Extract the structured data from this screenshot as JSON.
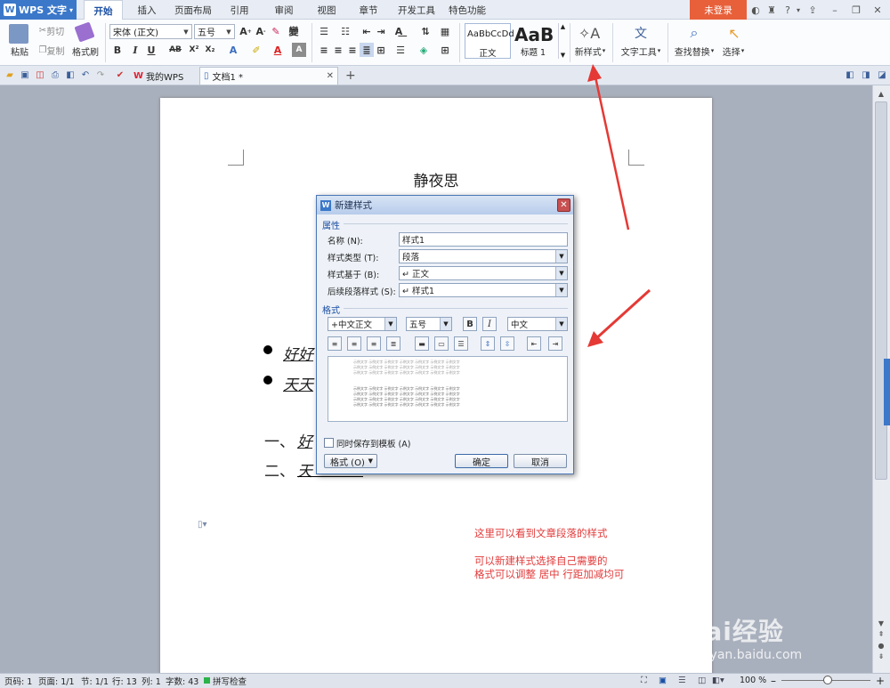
{
  "app": {
    "name": "WPS 文字",
    "logo": "W"
  },
  "tabs": [
    "开始",
    "插入",
    "页面布局",
    "引用",
    "审阅",
    "视图",
    "章节",
    "开发工具",
    "特色功能"
  ],
  "active_tab": "开始",
  "login_label": "未登录",
  "ribbon": {
    "paste": "粘贴",
    "cut": "剪切",
    "copy": "复制",
    "format_painter": "格式刷",
    "font_name": "宋体 (正文)",
    "font_size": "五号",
    "style_normal_preview": "AaBbCcDd",
    "style_normal": "正文",
    "style_heading_preview": "AaB",
    "style_heading": "标题 1",
    "new_style": "新样式",
    "text_tools": "文字工具",
    "find_replace": "查找替换",
    "select": "选择"
  },
  "doc_tabs": {
    "mywps": "我的WPS",
    "doc": "文档1 *"
  },
  "document": {
    "title": "静夜思",
    "bullet1": "好好",
    "bullet2": "天天",
    "num1_prefix": "一、",
    "num1_text": "好",
    "num2_prefix": "二、",
    "num2_text": "天"
  },
  "dialog": {
    "title": "新建样式",
    "section_props": "属性",
    "name_label": "名称 (N):",
    "name_value": "样式1",
    "type_label": "样式类型 (T):",
    "type_value": "段落",
    "based_label": "样式基于 (B):",
    "based_value": "↵ 正文",
    "next_label": "后续段落样式 (S):",
    "next_value": "↵ 样式1",
    "section_format": "格式",
    "font_value": "+中文正文",
    "size_value": "五号",
    "bold": "B",
    "italic": "I",
    "lang_value": "中文",
    "preview_line": "示例文字 示例文字 示例文字 示例文字 示例文字 示例文字 示例文字",
    "save_template": "同时保存到模板 (A)",
    "format_btn": "格式 (O)",
    "ok": "确定",
    "cancel": "取消"
  },
  "annotations": {
    "line1": "这里可以看到文章段落的样式",
    "line2": "可以新建样式选择自己需要的",
    "line3": "格式可以调整 居中 行距加减均可"
  },
  "statusbar": {
    "page_code": "页码: 1",
    "pages": "页面: 1/1",
    "section": "节: 1/1",
    "line": "行: 13",
    "column": "列: 1",
    "words": "字数: 43",
    "spell": "拼写检查",
    "zoom": "100 %"
  },
  "watermark": {
    "text": "Bai经验",
    "sub": "jingyan.baidu.com"
  },
  "colors": {
    "accent": "#3b78c9",
    "login": "#e8603a",
    "annotation": "#e23b3b",
    "arrow": "#e53935"
  }
}
